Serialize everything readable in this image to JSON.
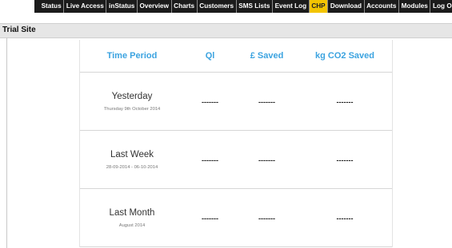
{
  "nav": {
    "items": [
      {
        "label": "Status",
        "active": false
      },
      {
        "label": "Live Access",
        "active": false
      },
      {
        "label": "inStatus",
        "active": false
      },
      {
        "label": "Overview",
        "active": false
      },
      {
        "label": "Charts",
        "active": false
      },
      {
        "label": "Customers",
        "active": false
      },
      {
        "label": "SMS Lists",
        "active": false
      },
      {
        "label": "Event Log",
        "active": false
      },
      {
        "label": "CHP",
        "active": true
      },
      {
        "label": "Download",
        "active": false
      },
      {
        "label": "Accounts",
        "active": false
      },
      {
        "label": "Modules",
        "active": false
      },
      {
        "label": "Log Out",
        "active": false
      }
    ],
    "active_color": "#f3c400"
  },
  "site": {
    "title": "Trial Site"
  },
  "table": {
    "headers": {
      "period": "Time Period",
      "ql": "Ql",
      "saved": "£ Saved",
      "co2": "kg CO2 Saved"
    },
    "header_color": "#3ba3e0",
    "rows": [
      {
        "name": "Yesterday",
        "sub": "Thursday 9th October 2014",
        "ql": "-------",
        "saved": "-------",
        "co2": "-------"
      },
      {
        "name": "Last Week",
        "sub": "28-09-2014 - 06-10-2014",
        "ql": "-------",
        "saved": "-------",
        "co2": "-------"
      },
      {
        "name": "Last Month",
        "sub": "August 2014",
        "ql": "-------",
        "saved": "-------",
        "co2": "-------"
      }
    ]
  }
}
